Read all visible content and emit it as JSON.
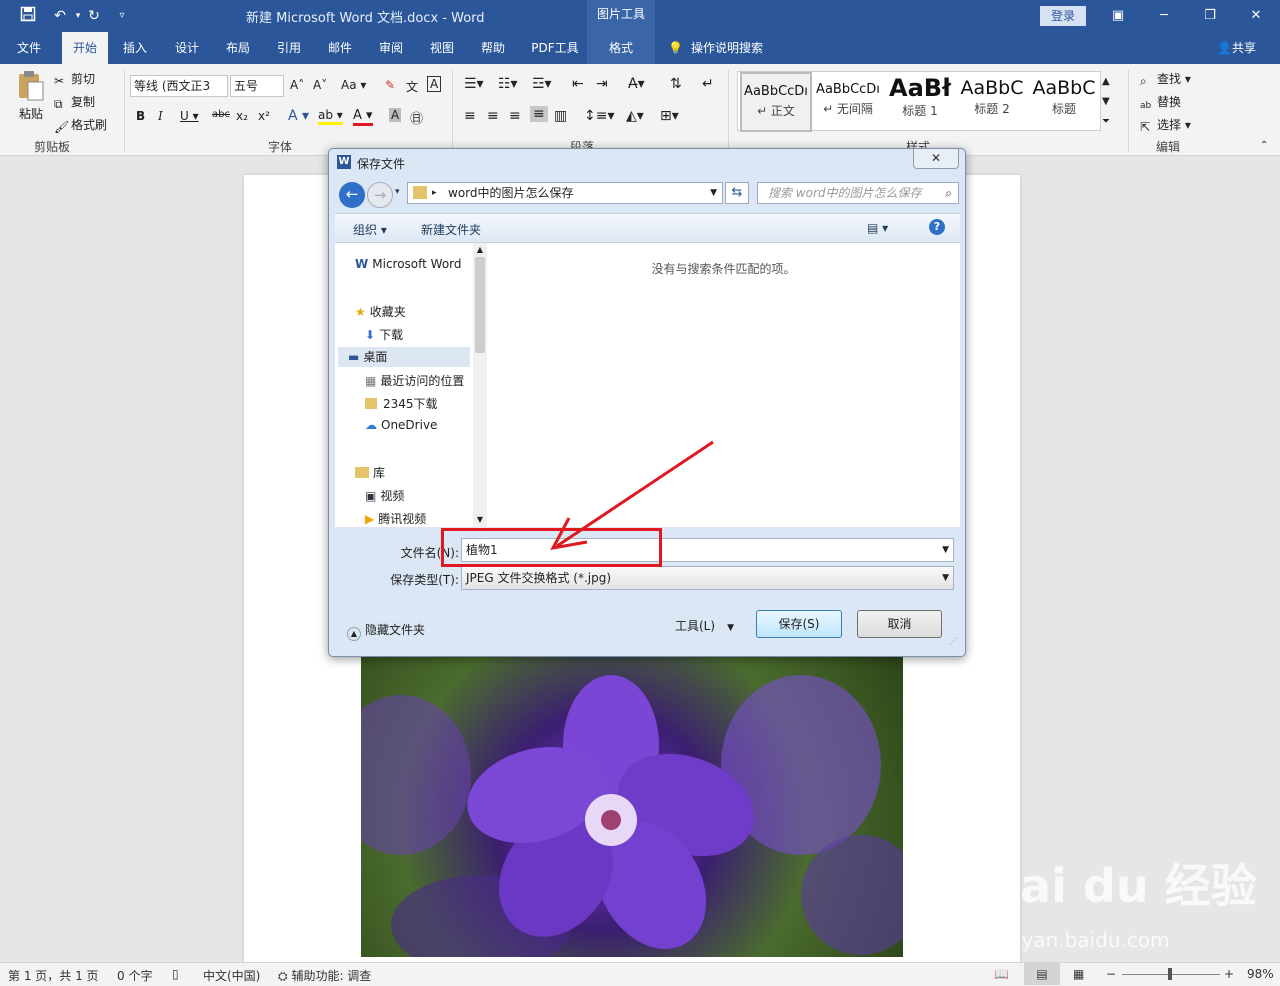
{
  "titlebar": {
    "document_title": "新建 Microsoft Word 文档.docx  -  Word",
    "context_tools": "图片工具",
    "login": "登录"
  },
  "tabs": {
    "file": "文件",
    "home": "开始",
    "insert": "插入",
    "design": "设计",
    "layout": "布局",
    "references": "引用",
    "mailings": "邮件",
    "review": "审阅",
    "view": "视图",
    "help": "帮助",
    "pdf": "PDF工具",
    "format": "格式",
    "tell_me": "操作说明搜索",
    "share": "共享"
  },
  "ribbon": {
    "clipboard": {
      "paste": "粘贴",
      "cut": "剪切",
      "copy": "复制",
      "format_painter": "格式刷",
      "label": "剪贴板"
    },
    "font": {
      "font_name": "等线 (西文正3",
      "font_size": "五号",
      "label": "字体",
      "case_label": "Aa"
    },
    "paragraph": {
      "label": "段落"
    },
    "styles": {
      "label": "样式",
      "items": [
        {
          "preview": "AaBbCcDı",
          "name": "↵ 正文"
        },
        {
          "preview": "AaBbCcDı",
          "name": "↵ 无间隔"
        },
        {
          "preview": "AaBł",
          "name": "标题 1"
        },
        {
          "preview": "AaBbC",
          "name": "标题 2"
        },
        {
          "preview": "AaBbC",
          "name": "标题"
        }
      ]
    },
    "editing": {
      "find": "查找",
      "replace": "替换",
      "select": "选择",
      "label": "编辑"
    }
  },
  "dialog": {
    "title": "保存文件",
    "address": "word中的图片怎么保存",
    "search_placeholder": "搜索 word中的图片怎么保存",
    "organize": "组织",
    "new_folder": "新建文件夹",
    "empty_message": "没有与搜索条件匹配的项。",
    "nav": {
      "microsoft_word": "Microsoft Word",
      "favorites": "收藏夹",
      "downloads": "下载",
      "desktop": "桌面",
      "recent": "最近访问的位置",
      "downloads_2345": "2345下载",
      "onedrive": "OneDrive",
      "libraries": "库",
      "videos": "视频",
      "tencent_video": "腾讯视频"
    },
    "filename_label": "文件名(N):",
    "filename_value": "植物1",
    "filetype_label": "保存类型(T):",
    "filetype_value": "JPEG 文件交换格式 (*.jpg)",
    "hide_folders": "隐藏文件夹",
    "tools": "工具(L)",
    "save": "保存(S)",
    "cancel": "取消"
  },
  "statusbar": {
    "page": "第 1 页，共 1 页",
    "words": "0 个字",
    "language": "中文(中国)",
    "accessibility": "辅助功能: 调查",
    "zoom": "98%",
    "zoom_level": 0.49
  },
  "watermark": {
    "brand": "Bai du 经验",
    "url": "jingyan.baidu.com"
  },
  "colors": {
    "accent": "#2b579a",
    "annotation": "#e0181f"
  }
}
